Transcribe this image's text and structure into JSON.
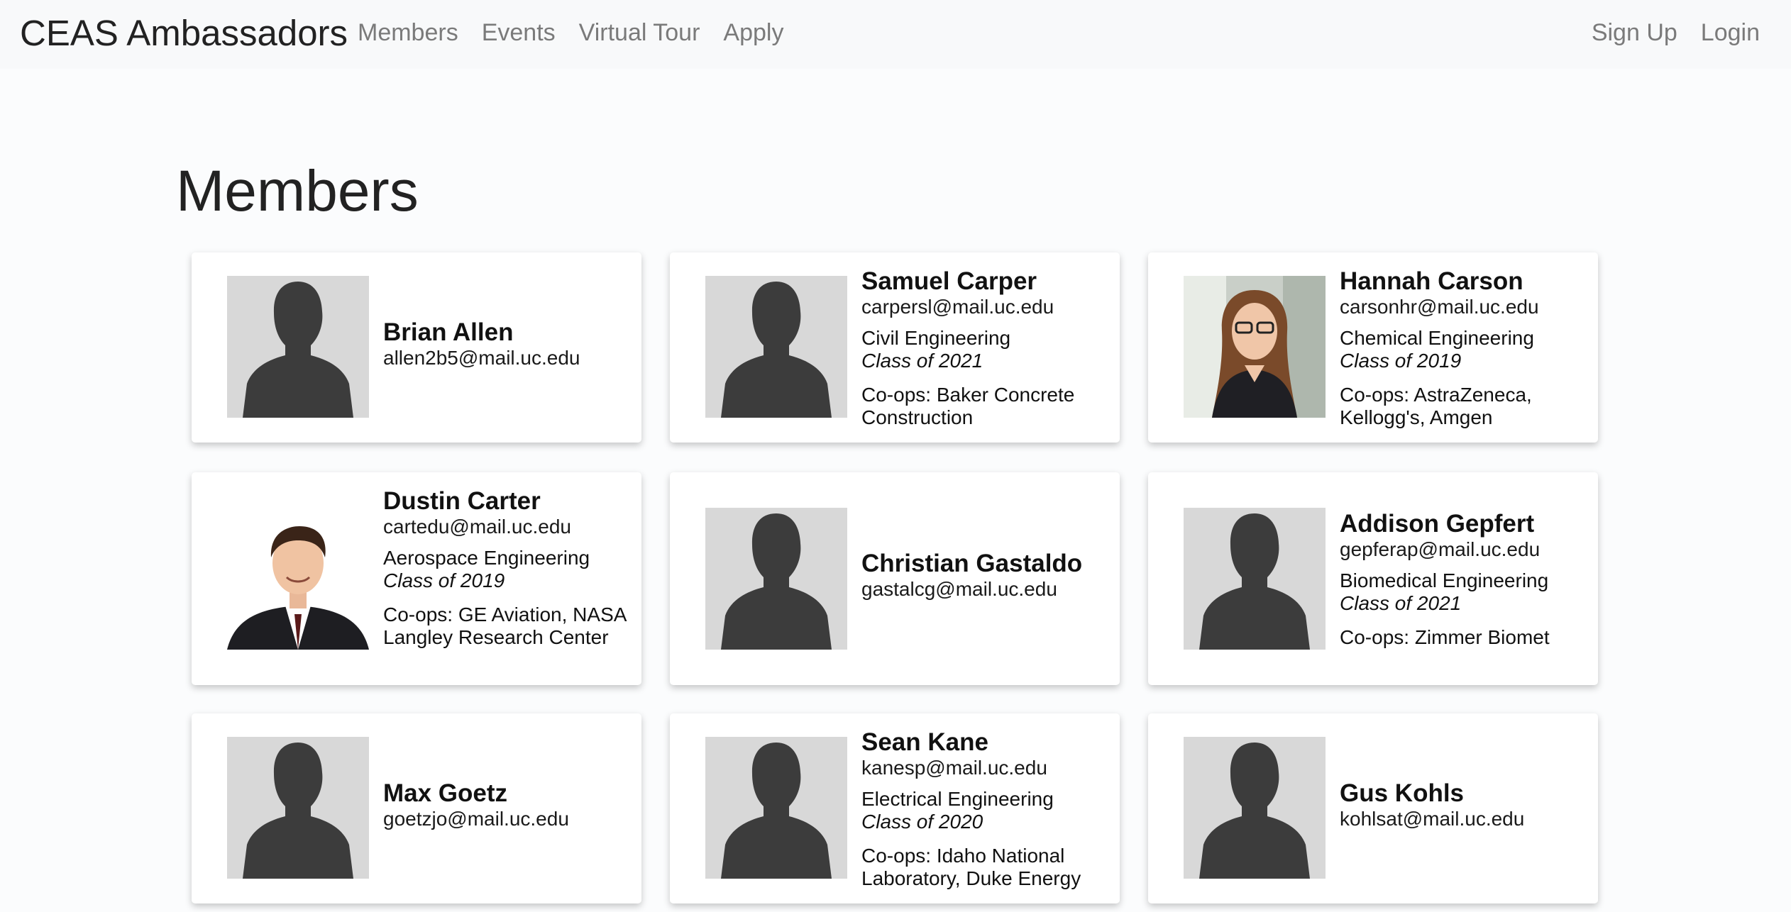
{
  "navbar": {
    "brand": "CEAS Ambassadors",
    "links": [
      "Members",
      "Events",
      "Virtual Tour",
      "Apply"
    ],
    "right_links": [
      "Sign Up",
      "Login"
    ]
  },
  "page": {
    "title": "Members"
  },
  "members": [
    {
      "name": "Brian Allen",
      "email": "allen2b5@mail.uc.edu",
      "major": "",
      "class": "",
      "coops": "",
      "photo": "placeholder-silhouette"
    },
    {
      "name": "Samuel Carper",
      "email": "carpersl@mail.uc.edu",
      "major": "Civil Engineering",
      "class": "Class of 2021",
      "coops": "Co-ops: Baker Concrete Construction",
      "photo": "placeholder-silhouette"
    },
    {
      "name": "Hannah Carson",
      "email": "carsonhr@mail.uc.edu",
      "major": "Chemical Engineering",
      "class": "Class of 2019",
      "coops": "Co-ops: AstraZeneca, Kellogg's, Amgen",
      "photo": "portrait-woman"
    },
    {
      "name": "Dustin Carter",
      "email": "cartedu@mail.uc.edu",
      "major": "Aerospace Engineering",
      "class": "Class of 2019",
      "coops": "Co-ops: GE Aviation, NASA Langley Research Center",
      "photo": "portrait-man"
    },
    {
      "name": "Christian Gastaldo",
      "email": "gastalcg@mail.uc.edu",
      "major": "",
      "class": "",
      "coops": "",
      "photo": "placeholder-silhouette"
    },
    {
      "name": "Addison Gepfert",
      "email": "gepferap@mail.uc.edu",
      "major": "Biomedical Engineering",
      "class": "Class of 2021",
      "coops": "Co-ops: Zimmer Biomet",
      "photo": "placeholder-silhouette"
    },
    {
      "name": "Max Goetz",
      "email": "goetzjo@mail.uc.edu",
      "major": "",
      "class": "",
      "coops": "",
      "photo": "placeholder-silhouette"
    },
    {
      "name": "Sean Kane",
      "email": "kanesp@mail.uc.edu",
      "major": "Electrical Engineering",
      "class": "Class of 2020",
      "coops": "Co-ops: Idaho National Laboratory, Duke Energy",
      "photo": "placeholder-silhouette"
    },
    {
      "name": "Gus Kohls",
      "email": "kohlsat@mail.uc.edu",
      "major": "",
      "class": "",
      "coops": "",
      "photo": "placeholder-silhouette"
    }
  ]
}
